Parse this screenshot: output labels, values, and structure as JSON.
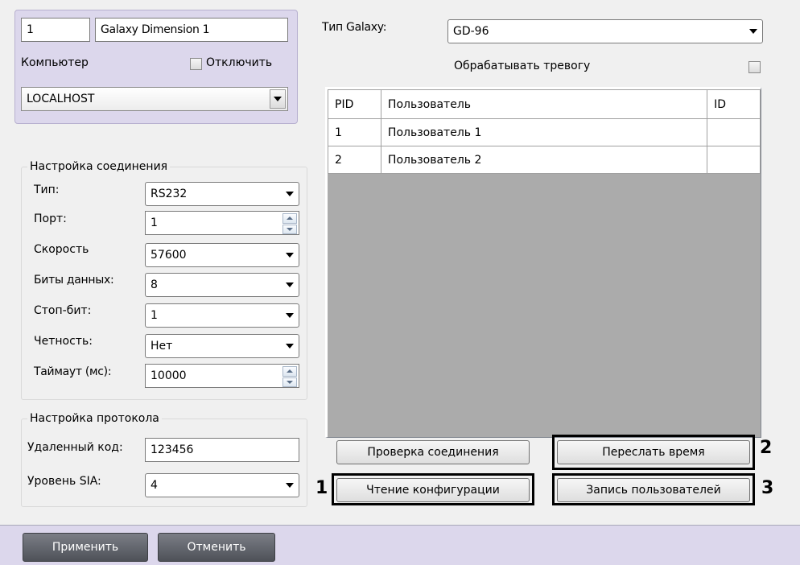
{
  "object": {
    "id": "1",
    "name": "Galaxy Dimension 1",
    "computer_label": "Компьютер",
    "disable_label": "Отключить",
    "computer_value": "LOCALHOST"
  },
  "connection": {
    "legend": "Настройка соединения",
    "type_label": "Тип:",
    "type_value": "RS232",
    "port_label": "Порт:",
    "port_value": "1",
    "speed_label": "Скорость",
    "speed_value": "57600",
    "databits_label": "Биты данных:",
    "databits_value": "8",
    "stopbit_label": "Стоп-бит:",
    "stopbit_value": "1",
    "parity_label": "Четность:",
    "parity_value": "Нет",
    "timeout_label": "Таймаут (мс):",
    "timeout_value": "10000"
  },
  "protocol": {
    "legend": "Настройка протокола",
    "remote_code_label": "Удаленный код:",
    "remote_code_value": "123456",
    "sia_label": "Уровень SIA:",
    "sia_value": "4"
  },
  "galaxy": {
    "type_label": "Тип Galaxy:",
    "type_value": "GD-96",
    "alarm_label": "Обрабатывать тревогу"
  },
  "users_table": {
    "columns": [
      "PID",
      "Пользователь",
      "ID"
    ],
    "rows": [
      {
        "pid": "1",
        "user": "Пользователь 1",
        "id": ""
      },
      {
        "pid": "2",
        "user": "Пользователь 2",
        "id": ""
      }
    ]
  },
  "actions": {
    "check_connection": "Проверка соединения",
    "send_time": "Переслать время",
    "read_config": "Чтение конфигурации",
    "write_users": "Запись пользователей"
  },
  "callouts": {
    "one": "1",
    "two": "2",
    "three": "3"
  },
  "footer": {
    "apply": "Применить",
    "cancel": "Отменить"
  }
}
